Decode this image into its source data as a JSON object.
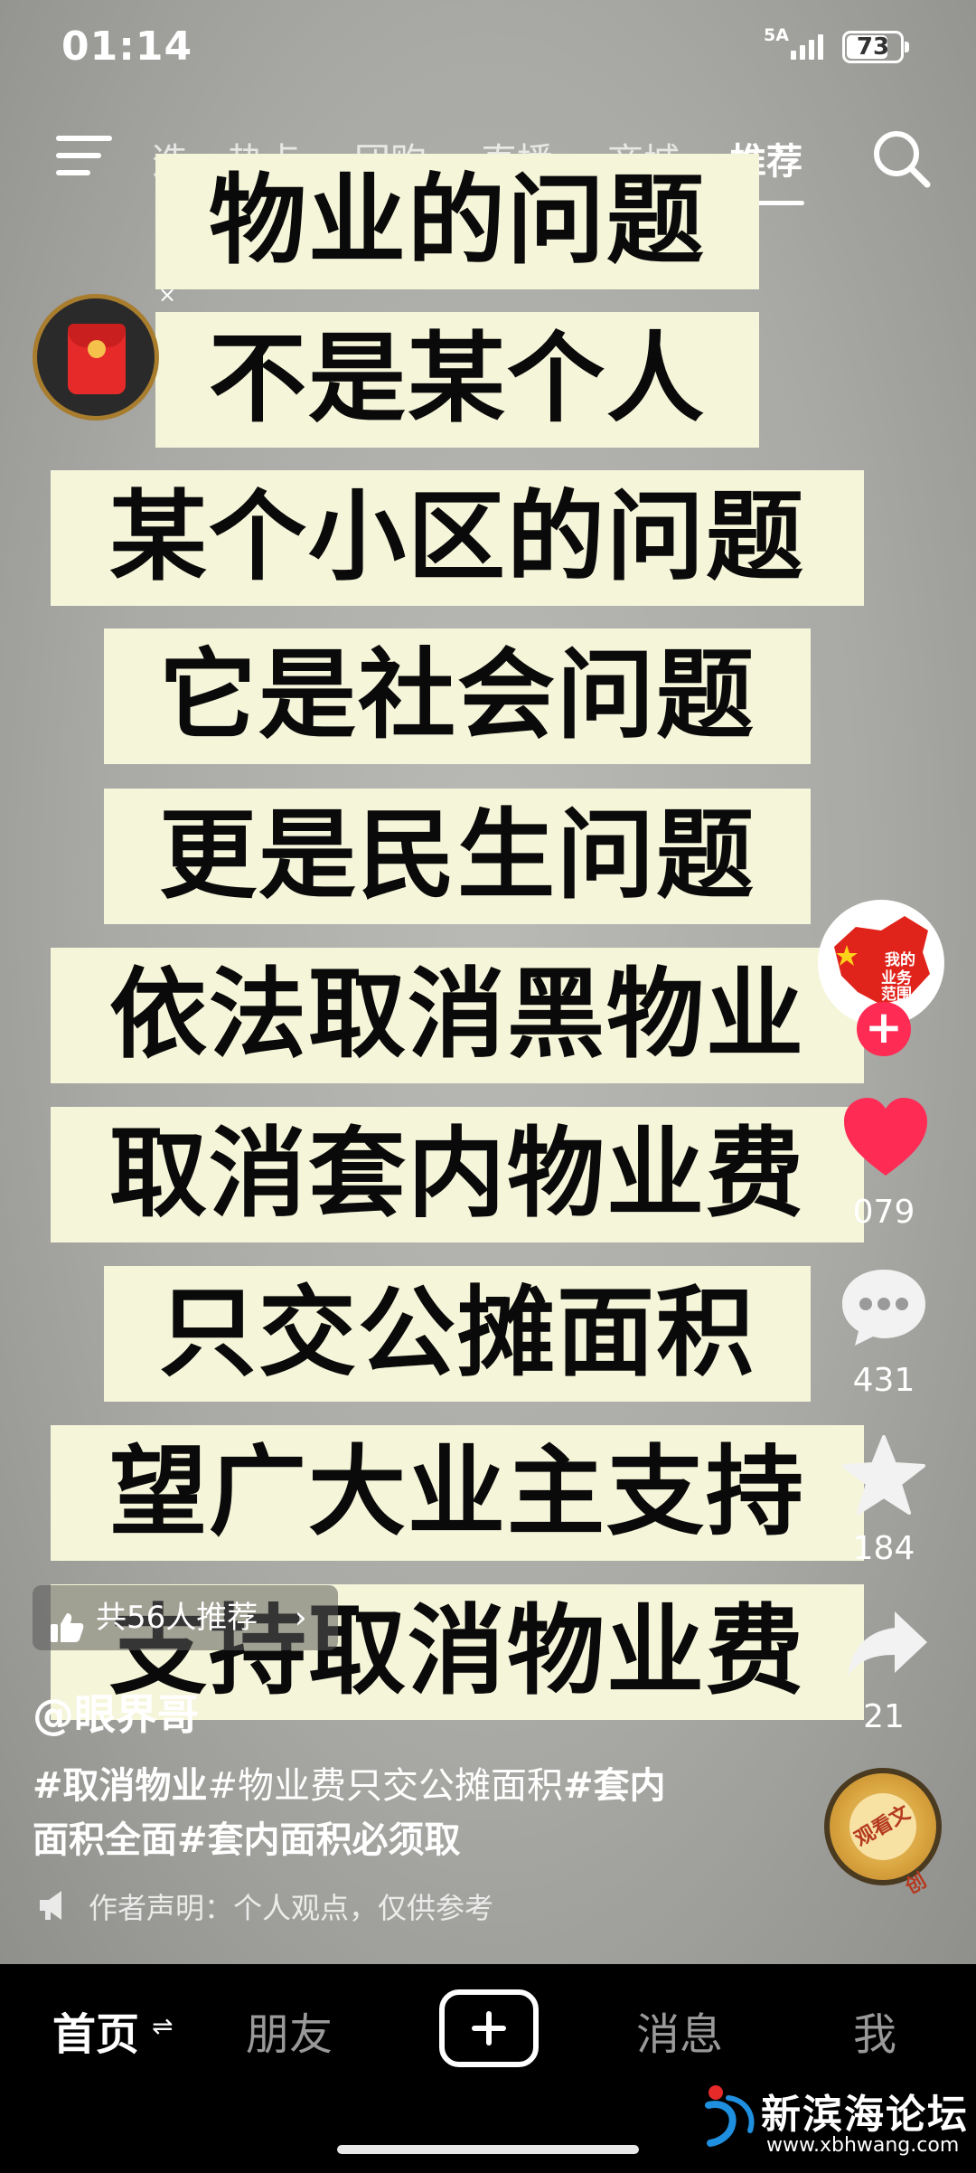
{
  "status_bar": {
    "time": "01:14",
    "network": "5A",
    "battery": "73",
    "battery_level": 0.73
  },
  "top_tabs": [
    {
      "label": "选"
    },
    {
      "label": "热点"
    },
    {
      "label": "团购"
    },
    {
      "label": "直播"
    },
    {
      "label": "商城"
    },
    {
      "label": "推荐",
      "active": true
    }
  ],
  "video": {
    "captions": [
      "物业的问题",
      "不是某个人",
      "某个小区的问题",
      "它是社会问题",
      "更是民生问题",
      "依法取消黑物业",
      "取消套内物业费",
      "只交公摊面积",
      "望广大业主支持",
      "支持取消物业费"
    ]
  },
  "widget": {
    "close": "×"
  },
  "avatar": {
    "text": "我的业务范围"
  },
  "actions": {
    "like_count": "079",
    "comment_count": "431",
    "favorite_count": "184",
    "share_count": "21"
  },
  "recommend": {
    "label": "共56人推荐",
    "chevron": "›"
  },
  "author": "@眼界哥",
  "description": {
    "line1_tag1": "#取消物业",
    "line1_rest": "#物业费只交公摊面积",
    "line1_tag2": "#套内",
    "line2": "面积全面#套内面积必须取"
  },
  "statement": "作者声明：个人观点，仅供参考",
  "music": {
    "label": "观看文创"
  },
  "bottom_nav": {
    "home": "首页",
    "home_switch": "⇌",
    "friends": "朋友",
    "messages": "消息",
    "me": "我"
  },
  "watermark": {
    "name": "新滨海论坛",
    "url": "www.xbhwang.com"
  },
  "colors": {
    "caption_bg": "#f5f5da",
    "like": "#fe2c55",
    "accent_red": "#e62a2a"
  }
}
